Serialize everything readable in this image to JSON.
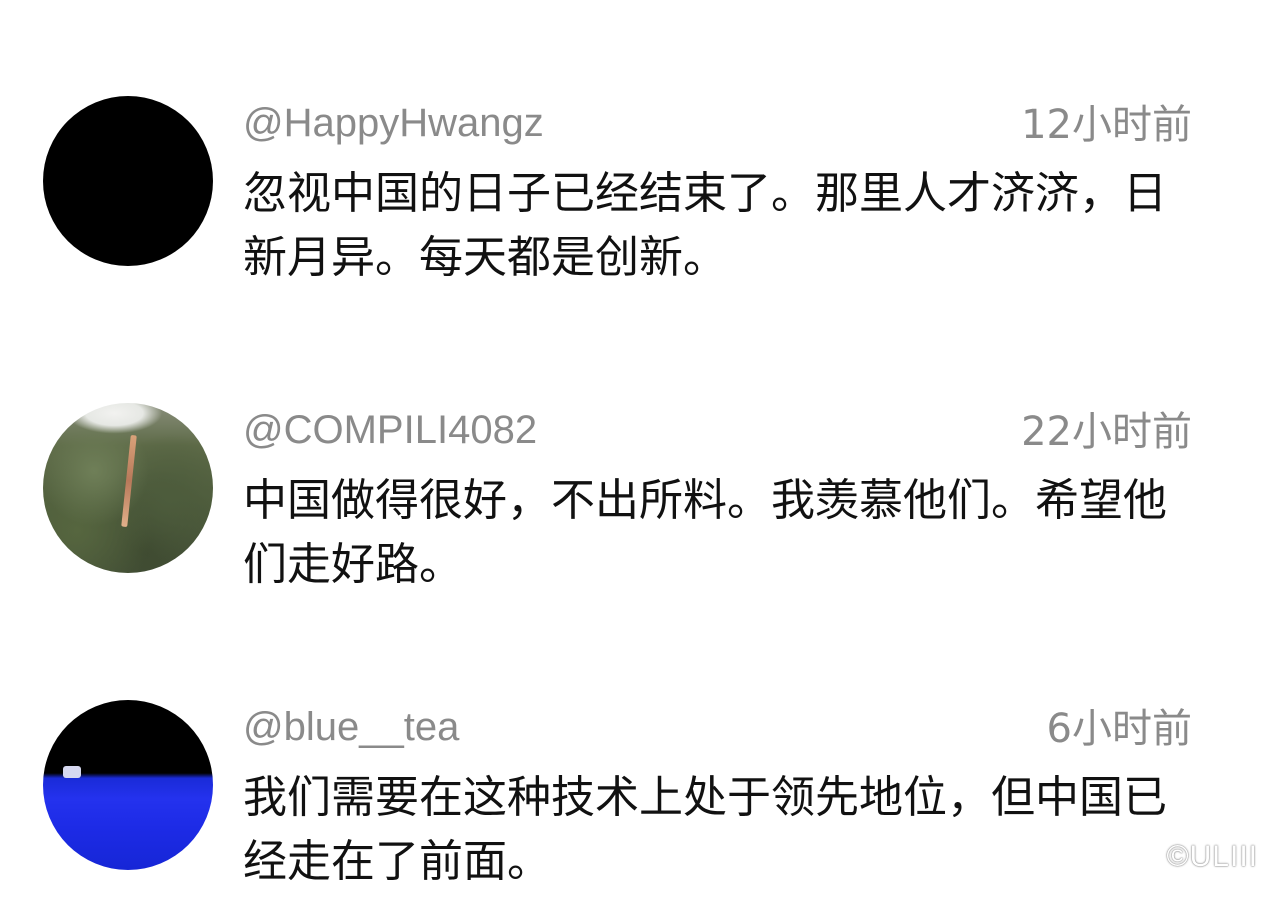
{
  "comments": [
    {
      "username": "@HappyHwangz",
      "time": "12小时前",
      "text": "忽视中国的日子已经结束了。那里人才济济，日新月异。每天都是创新。"
    },
    {
      "username": "@COMPILI4082",
      "time": "22小时前",
      "text": "中国做得很好，不出所料。我羡慕他们。希望他们走好路。"
    },
    {
      "username": "@blue__tea",
      "time": "6小时前",
      "text": "我们需要在这种技术上处于领先地位，但中国已经走在了前面。"
    }
  ],
  "watermark": "©ULIII"
}
